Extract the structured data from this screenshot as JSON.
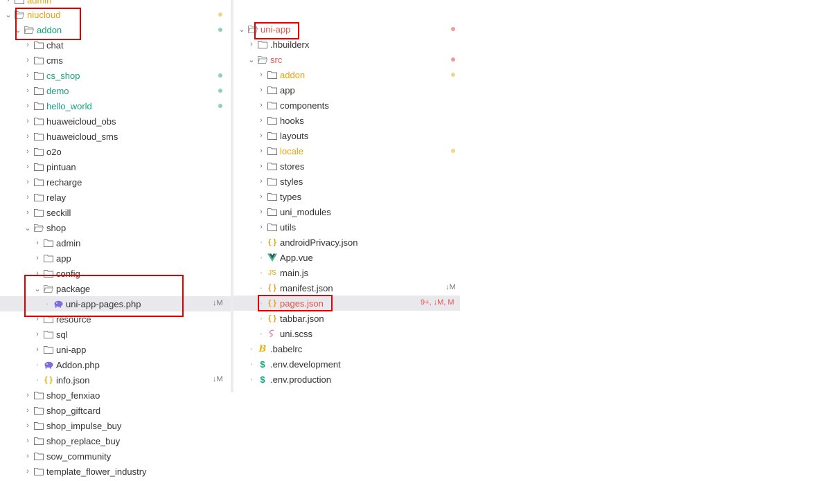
{
  "colors": {
    "added_green": "#14a37a",
    "modified_orange": "#e8a20c",
    "error_red": "#e5544a",
    "dot_green": "#8fd1b9",
    "dot_orange": "#f3d48b",
    "dot_red": "#f19a9a",
    "highlight_box": "#e00000",
    "selected_row": "#e8e8ed"
  },
  "left_tree": {
    "partial_top": "admin",
    "niucloud": "niucloud",
    "addon": "addon",
    "chat": "chat",
    "cms": "cms",
    "cs_shop": "cs_shop",
    "demo": "demo",
    "hello_world": "hello_world",
    "huaweicloud_obs": "huaweicloud_obs",
    "huaweicloud_sms": "huaweicloud_sms",
    "o2o": "o2o",
    "pintuan": "pintuan",
    "recharge": "recharge",
    "relay": "relay",
    "seckill": "seckill",
    "shop": "shop",
    "admin": "admin",
    "app": "app",
    "config": "config",
    "package": "package",
    "uni_app_pages_php": "uni-app-pages.php",
    "uni_app_pages_php_badge": "↓M",
    "resource": "resource",
    "sql": "sql",
    "uni_app": "uni-app",
    "addon_php": "Addon.php",
    "info_json": "info.json",
    "info_json_badge": "↓M",
    "shop_fenxiao": "shop_fenxiao",
    "shop_giftcard": "shop_giftcard",
    "shop_impulse_buy": "shop_impulse_buy",
    "shop_replace_buy": "shop_replace_buy",
    "sow_community": "sow_community",
    "template_flower_industry": "template_flower_industry"
  },
  "right_tree": {
    "uni_app": "uni-app",
    "hbuilderx": ".hbuilderx",
    "src": "src",
    "addon": "addon",
    "app": "app",
    "components": "components",
    "hooks": "hooks",
    "layouts": "layouts",
    "locale": "locale",
    "stores": "stores",
    "styles": "styles",
    "types": "types",
    "uni_modules": "uni_modules",
    "utils": "utils",
    "android_privacy_json": "androidPrivacy.json",
    "app_vue": "App.vue",
    "main_js": "main.js",
    "manifest_json": "manifest.json",
    "manifest_json_badge": "↓M",
    "pages_json": "pages.json",
    "pages_json_badge": "9+, ↓M, M",
    "tabbar_json": "tabbar.json",
    "uni_scss": "uni.scss",
    "babelrc": ".babelrc",
    "env_development": ".env.development",
    "env_production": ".env.production"
  },
  "icons": {
    "folder_closed": "folder-icon",
    "folder_open": "folder-open-icon",
    "php_file": "php-elephant-icon",
    "json_file": "json-braces-icon",
    "vue_file": "vue-logo-icon",
    "js_file": "js-file-icon",
    "scss_file": "sass-icon",
    "babel_file": "babel-icon",
    "env_file": "dollar-env-icon"
  }
}
